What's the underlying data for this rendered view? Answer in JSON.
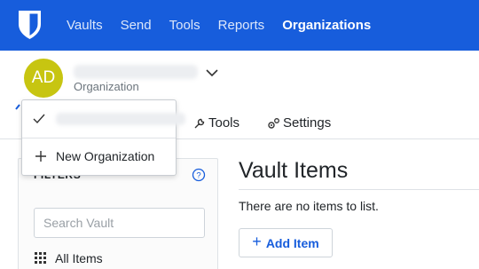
{
  "nav": {
    "links": [
      "Vaults",
      "Send",
      "Tools",
      "Reports",
      "Organizations"
    ],
    "active": "Organizations",
    "brand_color": "#175ddc"
  },
  "org": {
    "avatar_initials": "AD",
    "avatar_color": "#c7c511",
    "subtitle": "Organization",
    "caret_icon": "chevron-down-icon"
  },
  "tabs": [
    {
      "label": "Tools",
      "icon": "wrench-icon"
    },
    {
      "label": "Settings",
      "icon": "gears-icon"
    }
  ],
  "filters": {
    "heading": "FILTERS",
    "help_icon": "question-circle-icon",
    "search_placeholder": "Search Vault",
    "all_items_label": "All Items",
    "all_items_icon": "grid-icon"
  },
  "main": {
    "title": "Vault Items",
    "empty_text": "There are no items to list.",
    "add_button_label": "Add Item",
    "add_button_icon": "plus-icon"
  },
  "dropdown": {
    "check_icon": "check-icon",
    "new_org_label": "New Organization",
    "new_org_icon": "plus-icon"
  }
}
